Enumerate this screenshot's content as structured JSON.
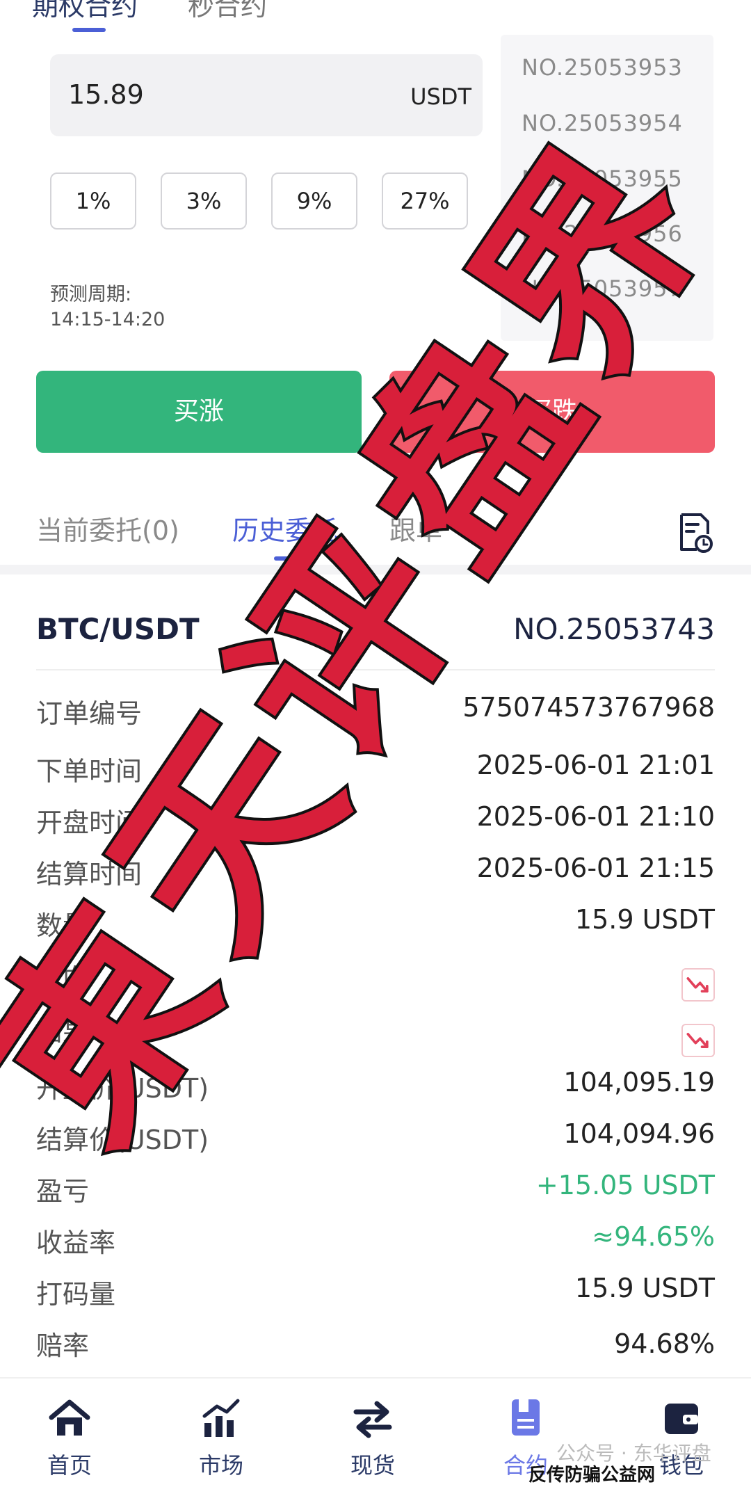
{
  "top_tabs": {
    "items": [
      "期权合约",
      "秒合约"
    ],
    "active_index": 0
  },
  "order_form": {
    "amount": "15.89",
    "unit": "USDT",
    "percent_options": [
      "1%",
      "3%",
      "9%",
      "27%"
    ],
    "period_label": "预测周期:",
    "period_value": "14:15-14:20"
  },
  "contracts": [
    "NO.25053953",
    "NO.25053954",
    "NO.25053955",
    "NO.25053956",
    "NO.25053957"
  ],
  "buttons": {
    "rise": "买涨",
    "fall": "买跌"
  },
  "order_tabs": {
    "items": [
      "当前委托(0)",
      "历史委托",
      "跟单"
    ],
    "active_index": 1
  },
  "order": {
    "pair": "BTC/USDT",
    "contract_no": "NO.25053743",
    "rows": [
      {
        "label": "订单编号",
        "value": "575074573767968"
      },
      {
        "label": "下单时间",
        "value": "2025-06-01 21:01"
      },
      {
        "label": "开盘时间",
        "value": "2025-06-01 21:10"
      },
      {
        "label": "结算时间",
        "value": "2025-06-01 21:15"
      },
      {
        "label": "数量",
        "value": "15.9 USDT"
      },
      {
        "label": "方向",
        "icon": "trend-down-icon"
      },
      {
        "label": "结果",
        "icon": "trend-down-icon"
      },
      {
        "label": "开盘价(USDT)",
        "value": "104,095.19"
      },
      {
        "label": "结算价(USDT)",
        "value": "104,094.96"
      },
      {
        "label": "盈亏",
        "value": "+15.05 USDT",
        "color": "#33b57c"
      },
      {
        "label": "收益率",
        "value": "≈94.65%",
        "color": "#33b57c"
      },
      {
        "label": "打码量",
        "value": "15.9 USDT"
      },
      {
        "label": "赔率",
        "value": "94.68%"
      }
    ]
  },
  "bottom_nav": {
    "items": [
      {
        "label": "首页",
        "icon": "home-icon"
      },
      {
        "label": "市场",
        "icon": "chart-icon"
      },
      {
        "label": "现货",
        "icon": "swap-icon"
      },
      {
        "label": "合约",
        "icon": "contract-icon"
      },
      {
        "label": "钱包",
        "icon": "wallet-icon"
      }
    ],
    "active_index": 3
  },
  "watermark": {
    "stamp_text": "東天评盘界",
    "footer_faint": "公众号 · 东华评盘",
    "footer": "反传防骗公益网 www.wazi.cc"
  },
  "colors": {
    "accent": "#4b5fd6",
    "rise": "#33b57c",
    "fall": "#f15b6b",
    "stamp": "#d81f3a"
  }
}
